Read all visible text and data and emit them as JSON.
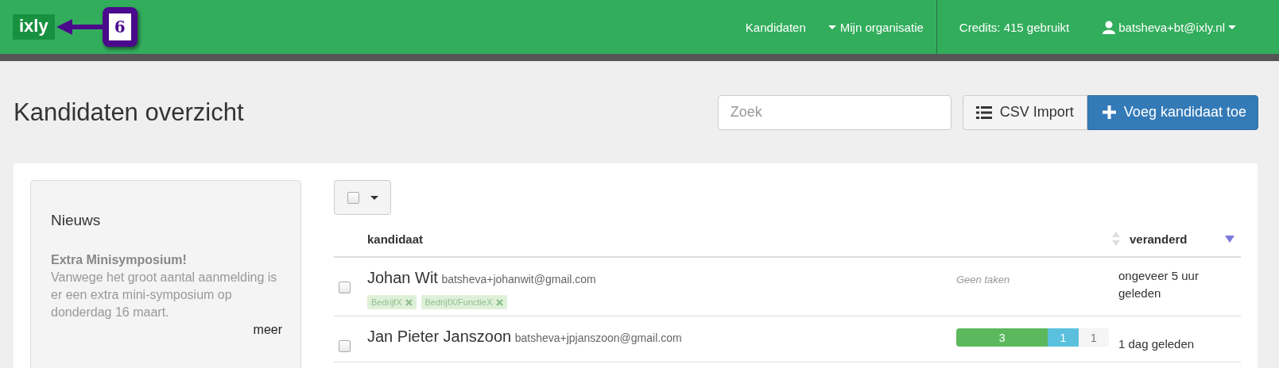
{
  "navbar": {
    "logo": "ixly",
    "callout": "6",
    "links": [
      {
        "label": "Kandidaten",
        "dropdown": false
      },
      {
        "label": "Mijn organisatie",
        "dropdown": true
      }
    ],
    "credits": "Credits: 415 gebruikt",
    "user": "batsheva+bt@ixly.nl"
  },
  "page": {
    "title": "Kandidaten overzicht",
    "search": {
      "placeholder": "Zoek"
    },
    "buttons": [
      {
        "label": "CSV Import",
        "kind": "default"
      },
      {
        "label": "Voeg kandidaat toe",
        "kind": "primary"
      }
    ]
  },
  "news": {
    "title": "Nieuws",
    "headline": "Extra Minisymposium!",
    "body": "Vanwege het groot aantal aanmelding is er een extra mini-symposium op donderdag 16 maart.",
    "more": "meer"
  },
  "table": {
    "select_all": {
      "checked": false
    },
    "columns": [
      "kandidaat",
      "veranderd"
    ],
    "rows": [
      {
        "name": "Johan Wit",
        "email": "batsheva+johanwit@gmail.com",
        "checked": false,
        "tags": [
          "BedrijfX",
          "BedrijfX/FunctieX"
        ],
        "tasks_text": "Geen taken",
        "changed": "ongeveer 5 uur geleden"
      },
      {
        "name": "Jan Pieter Janszoon",
        "email": "batsheva+jpjanszoon@gmail.com",
        "checked": false,
        "progress": [
          {
            "label": "3",
            "color": "#5cb85c"
          },
          {
            "label": "1",
            "color": "#5bc0de"
          },
          {
            "label": "1",
            "color": "#f5f5f5"
          }
        ],
        "changed": "1 dag geleden"
      }
    ]
  }
}
